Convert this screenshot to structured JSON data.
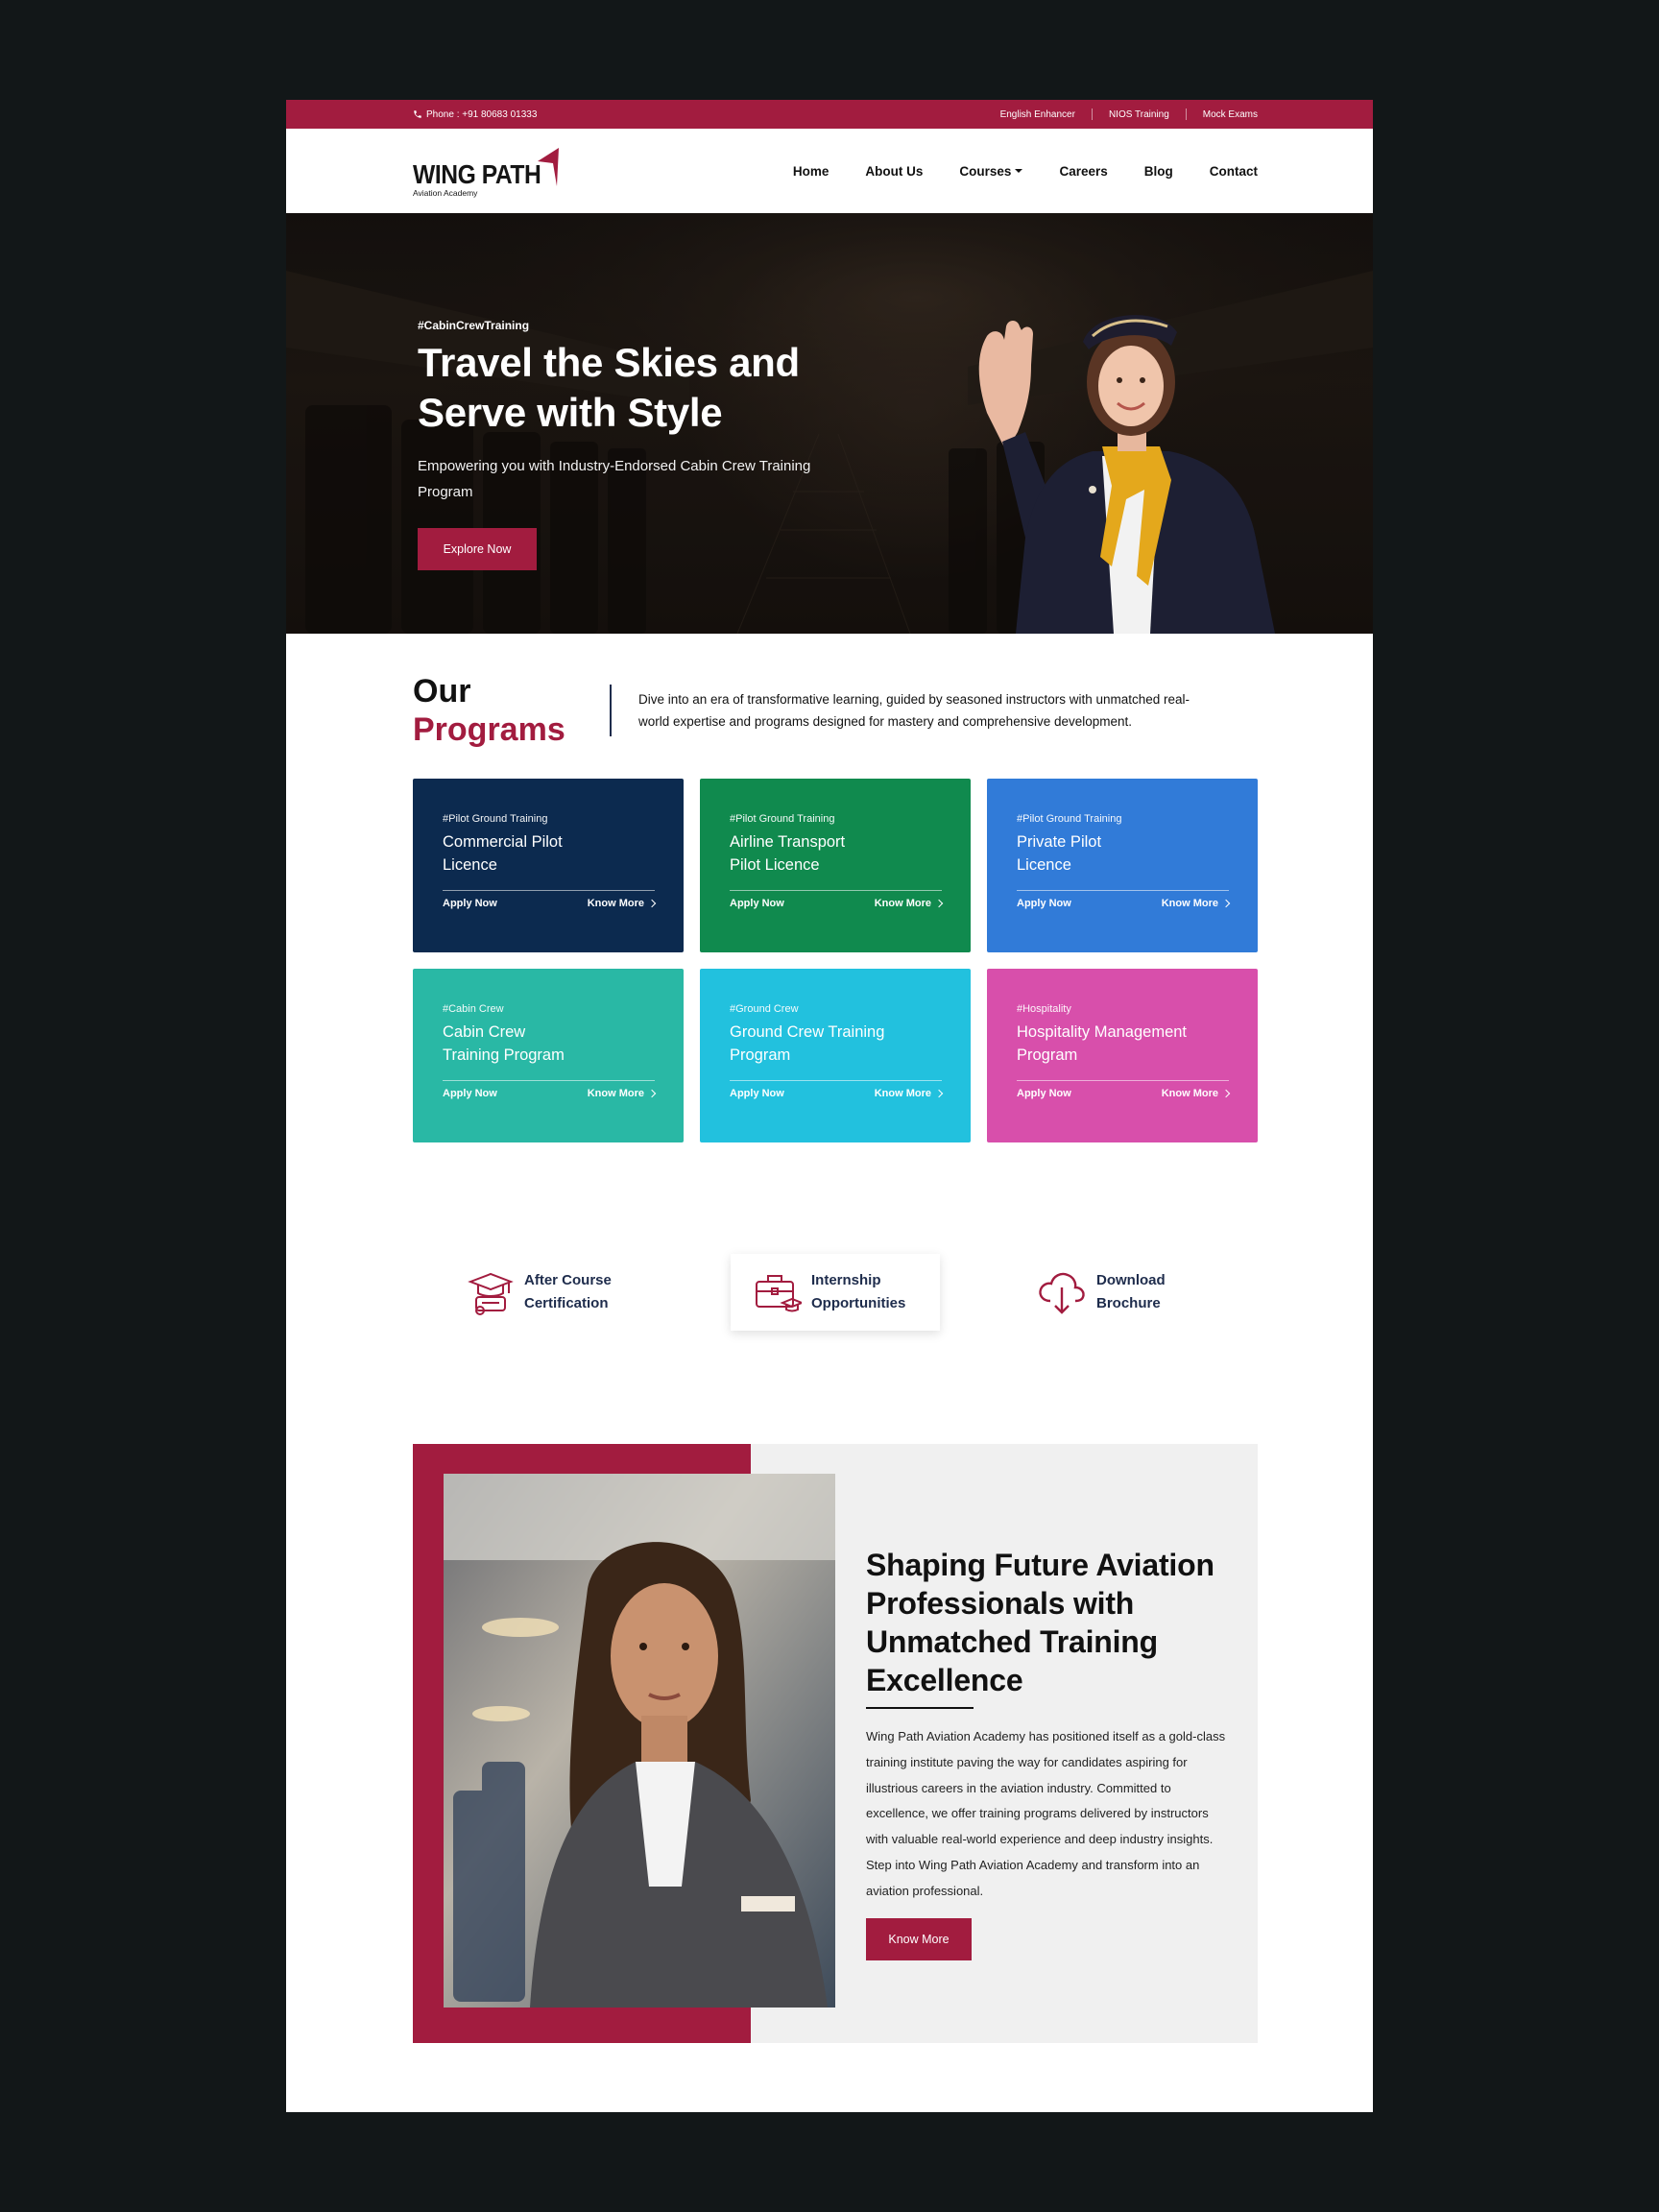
{
  "colors": {
    "brand": "#a21c3f",
    "navy": "#1e2c4c",
    "backdrop": "#121718"
  },
  "topbar": {
    "phone": "Phone : +91 80683 01333",
    "links": [
      "English Enhancer",
      "NIOS Training",
      "Mock Exams"
    ]
  },
  "logo": {
    "name": "WING PATH",
    "tagline": "Aviation Academy"
  },
  "nav": {
    "items": [
      "Home",
      "About Us",
      "Courses",
      "Careers",
      "Blog",
      "Contact"
    ]
  },
  "hero": {
    "tag": "#CabinCrewTraining",
    "title_line1": "Travel the Skies and",
    "title_line2": "Serve with Style",
    "subtitle": "Empowering you with Industry-Endorsed Cabin Crew Training Program",
    "cta": "Explore Now"
  },
  "programs": {
    "title_line1": "Our",
    "title_line2": "Programs",
    "description": "Dive into an era of transformative learning, guided by seasoned instructors with unmatched real-world expertise and programs designed for mastery and comprehensive development.",
    "cards": [
      {
        "tag": "#Pilot Ground Training",
        "name_l1": "Commercial Pilot",
        "name_l2": "Licence",
        "color": "#0c2a4f",
        "apply": "Apply Now",
        "more": "Know More"
      },
      {
        "tag": "#Pilot Ground Training",
        "name_l1": "Airline Transport",
        "name_l2": "Pilot Licence",
        "color": "#108a4e",
        "apply": "Apply Now",
        "more": "Know More"
      },
      {
        "tag": "#Pilot Ground Training",
        "name_l1": "Private Pilot",
        "name_l2": "Licence",
        "color": "#317bd8",
        "apply": "Apply Now",
        "more": "Know More"
      },
      {
        "tag": "#Cabin Crew",
        "name_l1": "Cabin Crew",
        "name_l2": "Training Program",
        "color": "#29b8a5",
        "apply": "Apply Now",
        "more": "Know More"
      },
      {
        "tag": "#Ground Crew",
        "name_l1": "Ground Crew Training",
        "name_l2": "Program",
        "color": "#22c1de",
        "apply": "Apply Now",
        "more": "Know More"
      },
      {
        "tag": "#Hospitality",
        "name_l1": "Hospitality Management",
        "name_l2": "Program",
        "color": "#d84fab",
        "apply": "Apply Now",
        "more": "Know More"
      }
    ]
  },
  "features": [
    {
      "l1": "After Course",
      "l2": "Certification",
      "icon": "graduation-certificate-icon"
    },
    {
      "l1": "Internship",
      "l2": "Opportunities",
      "icon": "briefcase-graduate-icon"
    },
    {
      "l1": "Download",
      "l2": "Brochure",
      "icon": "cloud-download-icon"
    }
  ],
  "about": {
    "title_l1": "Shaping Future Aviation",
    "title_l2": "Professionals with",
    "title_l3": "Unmatched Training",
    "title_l4": "Excellence",
    "body": "Wing Path Aviation Academy has positioned itself as a gold-class training institute paving the way for candidates aspiring for illustrious careers in the aviation industry. Committed to excellence, we offer training programs delivered by instructors with valuable real-world experience and deep industry insights. Step into Wing Path Aviation Academy and transform into an aviation professional.",
    "cta": "Know More"
  }
}
